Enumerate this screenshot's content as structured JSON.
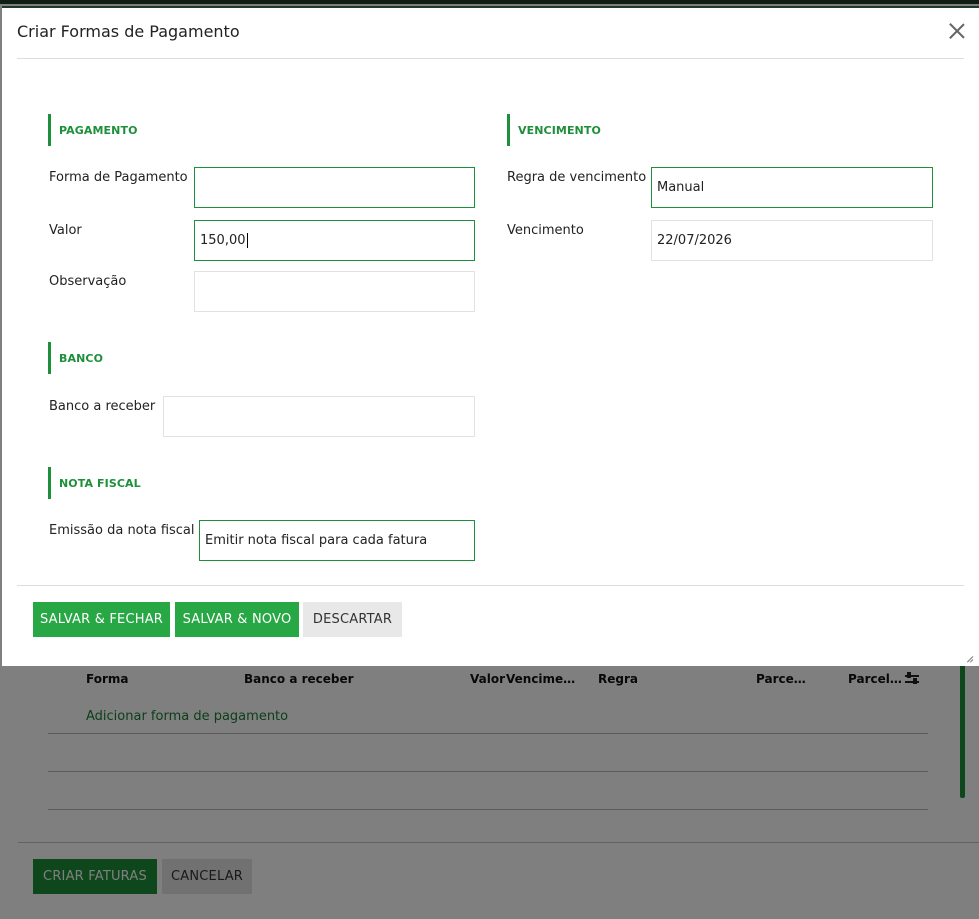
{
  "background": {
    "table_headers": [
      "Forma",
      "Banco a receber",
      "Valor",
      "Vencime…",
      "Regra",
      "Parce…",
      "Parcel…"
    ],
    "add_link": "Adicionar forma de pagamento",
    "buttons": {
      "create_invoices": "CRIAR FATURAS",
      "cancel": "CANCELAR"
    },
    "icons": {
      "columns": "tune-icon"
    }
  },
  "modal": {
    "title": "Criar Formas de Pagamento",
    "close_icon": "close-icon",
    "sections": {
      "pagamento": "PAGAMENTO",
      "vencimento": "VENCIMENTO",
      "banco": "BANCO",
      "nota_fiscal": "NOTA FISCAL"
    },
    "fields": {
      "forma_pagamento": {
        "label": "Forma de Pagamento",
        "value": ""
      },
      "valor": {
        "label": "Valor",
        "value": "150,00"
      },
      "observacao": {
        "label": "Observação",
        "value": ""
      },
      "regra_vencimento": {
        "label": "Regra de vencimento",
        "value": "Manual"
      },
      "vencimento": {
        "label": "Vencimento",
        "value": "22/07/2026"
      },
      "banco_receber": {
        "label": "Banco a receber",
        "value": ""
      },
      "emissao_nota": {
        "label": "Emissão da nota fiscal",
        "value": "Emitir nota fiscal para cada fatura"
      }
    },
    "buttons": {
      "save_close": "SALVAR & FECHAR",
      "save_new": "SALVAR & NOVO",
      "discard": "DESCARTAR"
    }
  },
  "colors": {
    "accent": "#28a745",
    "accent_dark": "#1e8f3a",
    "header_bar": "#1f3b2a"
  }
}
